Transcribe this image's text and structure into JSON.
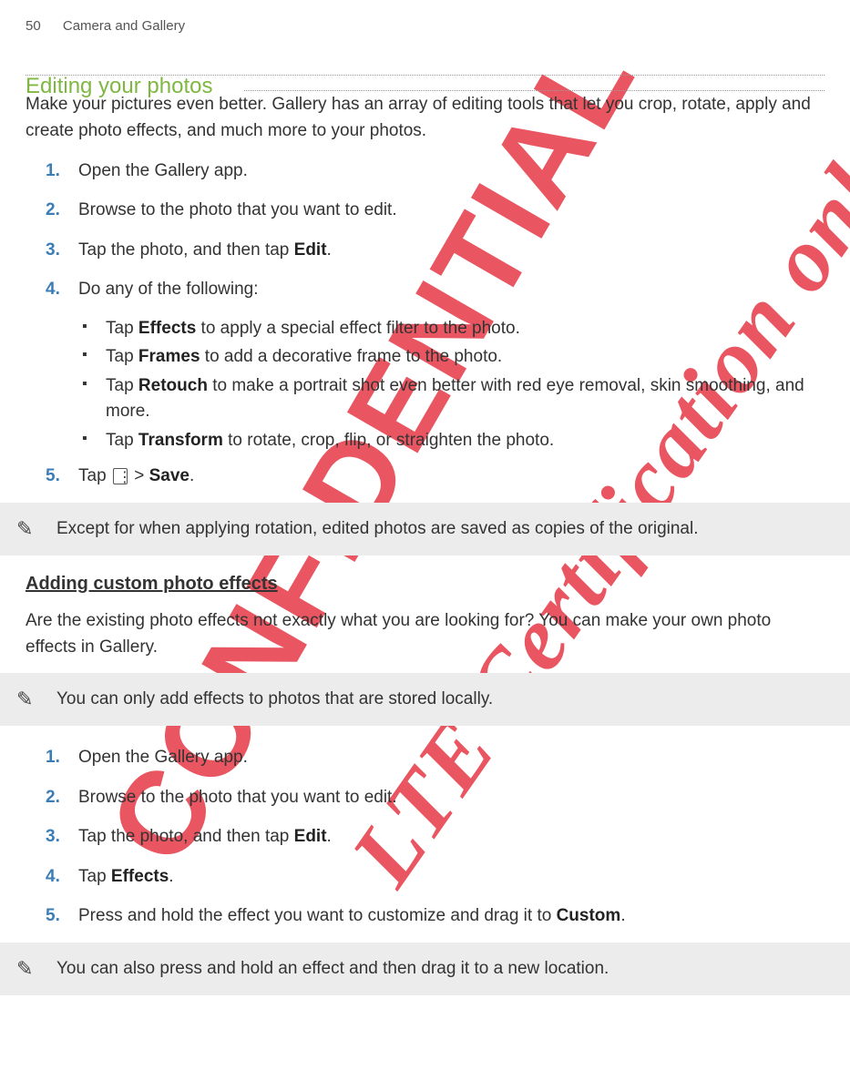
{
  "header": {
    "page_number": "50",
    "chapter": "Camera and Gallery"
  },
  "section": {
    "title": "Editing your photos",
    "intro": "Make your pictures even better. Gallery has an array of editing tools that let you crop, rotate, apply and create photo effects, and much more to your photos."
  },
  "steps1": {
    "s1": "Open the Gallery app.",
    "s2": "Browse to the photo that you want to edit.",
    "s3_a": "Tap the photo, and then tap ",
    "s3_b": "Edit",
    "s3_c": ".",
    "s4": "Do any of the following:",
    "s4_b1_a": "Tap ",
    "s4_b1_b": "Effects",
    "s4_b1_c": " to apply a special effect filter to the photo.",
    "s4_b2_a": "Tap ",
    "s4_b2_b": "Frames",
    "s4_b2_c": " to add a decorative frame to the photo.",
    "s4_b3_a": "Tap ",
    "s4_b3_b": "Retouch",
    "s4_b3_c": " to make a portrait shot even better with red eye removal, skin smoothing, and more.",
    "s4_b4_a": "Tap ",
    "s4_b4_b": "Transform",
    "s4_b4_c": " to rotate, crop, flip, or straighten the photo.",
    "s5_a": "Tap ",
    "s5_b": " > ",
    "s5_c": "Save",
    "s5_d": "."
  },
  "note1": "Except for when applying rotation, edited photos are saved as copies of the original.",
  "sub": {
    "heading": "Adding custom photo effects",
    "intro": "Are the existing photo effects not exactly what you are looking for? You can make your own photo effects in Gallery."
  },
  "note2": "You can only add effects to photos that are stored locally.",
  "steps2": {
    "s1": "Open the Gallery app.",
    "s2": "Browse to the photo that you want to edit.",
    "s3_a": "Tap the photo, and then tap ",
    "s3_b": "Edit",
    "s3_c": ".",
    "s4_a": "Tap ",
    "s4_b": "Effects",
    "s4_c": ".",
    "s5_a": "Press and hold the effect you want to customize and drag it to ",
    "s5_b": "Custom",
    "s5_c": "."
  },
  "note3": "You can also press and hold an effect and then drag it to a new location.",
  "watermark1": "CONFIDENTIAL",
  "watermark2": "LTE Certification only"
}
